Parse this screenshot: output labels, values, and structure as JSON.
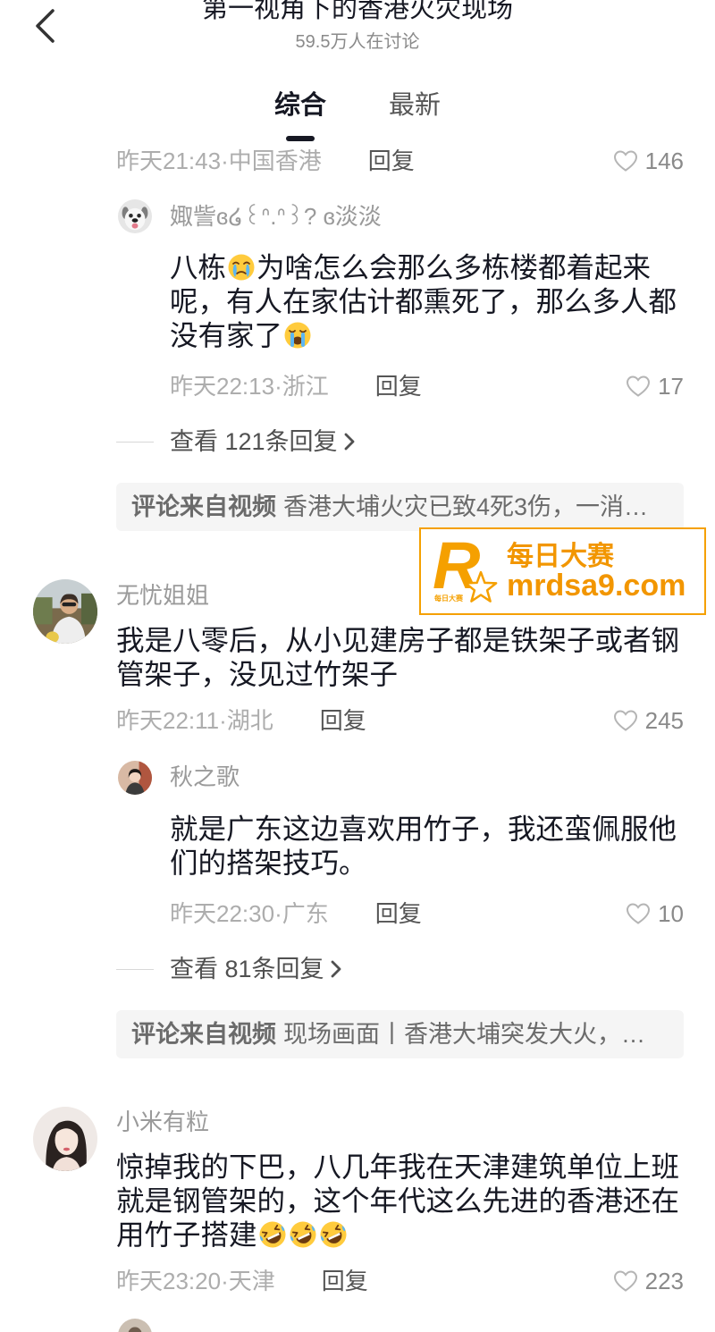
{
  "header": {
    "back_icon": "chevron-left-icon",
    "title": "第一视角下的香港火灾现场",
    "subtitle": "59.5万人在讨论"
  },
  "tabs": [
    {
      "label": "综合",
      "active": true
    },
    {
      "label": "最新",
      "active": false
    }
  ],
  "threads": [
    {
      "comment": {
        "time_location": "昨天21:43·中国香港",
        "reply_label": "回复",
        "like_icon": "heart-outline-icon",
        "likes": "146"
      },
      "reply": {
        "avatar": "dog-avatar",
        "author": "娵訾ɞ໒꒰ᐢ.ᐢ꒱? ɞ淡淡",
        "lines": [
          {
            "text": "八栋",
            "emoji": "tearful-face",
            "text_after": "为啥怎么会那么多栋楼都着起来"
          },
          {
            "text": "呢，有人在家估计都熏死了，那么多人都"
          },
          {
            "text": "没有家了",
            "emoji": "loudly-crying-face"
          }
        ],
        "time_location": "昨天22:13·浙江",
        "reply_label": "回复",
        "likes": "17"
      },
      "view_replies": "查看 121条回复",
      "video_source": {
        "label": "评论来自视频",
        "title": "香港大埔火灾已致4死3伤，一消…"
      }
    },
    {
      "comment": {
        "avatar": "woman-outdoor-avatar",
        "author": "无忧姐姐",
        "lines": [
          {
            "text": "我是八零后，从小见建房子都是铁架子或者钢"
          },
          {
            "text": "管架子，没见过竹架子"
          }
        ],
        "time_location": "昨天22:11·湖北",
        "reply_label": "回复",
        "likes": "245"
      },
      "reply": {
        "avatar": "woman-portrait-avatar",
        "author": "秋之歌",
        "lines": [
          {
            "text": "就是广东这边喜欢用竹子，我还蛮佩服他"
          },
          {
            "text": "们的搭架技巧。"
          }
        ],
        "time_location": "昨天22:30·广东",
        "reply_label": "回复",
        "likes": "10"
      },
      "view_replies": "查看 81条回复",
      "video_source": {
        "label": "评论来自视频",
        "title": "现场画面丨香港大埔突发大火，…"
      }
    },
    {
      "comment": {
        "avatar": "woman-long-hair-avatar",
        "author": "小米有粒",
        "lines": [
          {
            "text": "惊掉我的下巴，八几年我在天津建筑单位上班"
          },
          {
            "text": "就是钢管架的，这个年代这么先进的香港还在"
          },
          {
            "text": "用竹子搭建",
            "emojis": [
              "rolling-on-floor-laughing-face",
              "rolling-on-floor-laughing-face",
              "rolling-on-floor-laughing-face"
            ]
          }
        ],
        "time_location": "昨天23:20·天津",
        "reply_label": "回复",
        "likes": "223"
      }
    }
  ],
  "watermark": {
    "logo_letter": "R",
    "logo_caption": "每日大赛",
    "name": "每日大赛",
    "url": "mrdsa9.com"
  },
  "colors": {
    "text_primary": "#161823",
    "text_muted": "#adadad",
    "watermark_orange": "#f29600",
    "source_box_bg": "#f5f5f5"
  }
}
